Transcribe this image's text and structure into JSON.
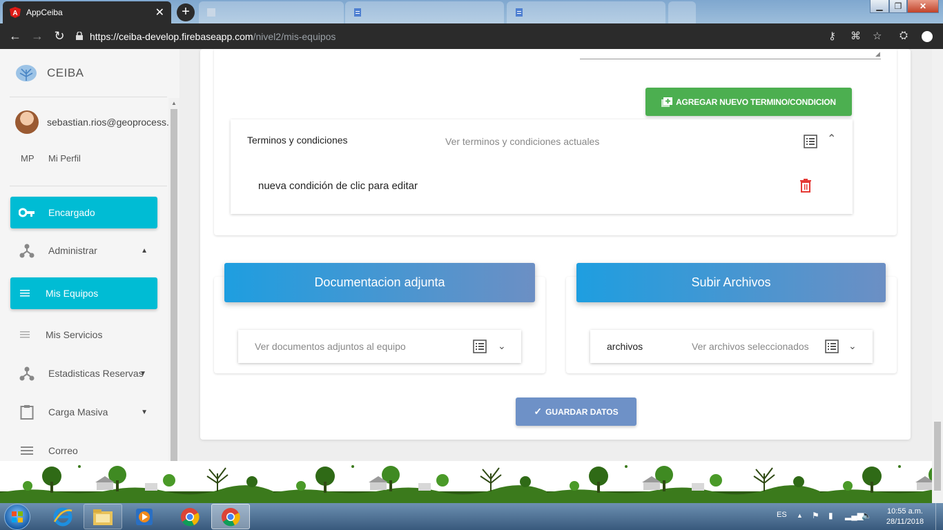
{
  "browser": {
    "active_tab": {
      "title": "AppCeiba",
      "favicon": "angular-icon"
    },
    "inactive_tabs": [
      {
        "title": "",
        "favicon": "generic-page-icon"
      },
      {
        "title": "",
        "favicon": "google-docs-icon"
      },
      {
        "title": "",
        "favicon": "google-docs-icon"
      }
    ],
    "new_tab_label": "+",
    "url_host": "https://ceiba-develop.firebaseapp.com",
    "url_path": "/nivel2/mis-equipos"
  },
  "sidebar": {
    "brand": "CEIBA",
    "user_email": "sebastian.rios@geoprocess.c",
    "profile_abbr": "MP",
    "profile_label": "Mi Perfil",
    "items": [
      {
        "label": "Encargado",
        "icon": "key-icon",
        "active": true
      },
      {
        "label": "Administrar",
        "icon": "hub-icon",
        "active": false,
        "caret": "▲"
      },
      {
        "label": "Mis Equipos",
        "icon": "list-icon",
        "active": true
      },
      {
        "label": "Mis Servicios",
        "icon": "list-icon",
        "active": false
      },
      {
        "label": "Estadisticas Reservas",
        "icon": "hub-icon",
        "active": false,
        "caret": "▼"
      },
      {
        "label": "Carga Masiva",
        "icon": "clipboard-icon",
        "active": false,
        "caret": "▼"
      },
      {
        "label": "Correo",
        "icon": "list-icon",
        "active": false
      }
    ]
  },
  "terms": {
    "add_button": "AGREGAR NUEVO TERMINO/CONDICION",
    "panel_title": "Terminos y condiciones",
    "panel_desc": "Ver terminos y condiciones actuales",
    "items": [
      "nueva condición de clic para editar"
    ]
  },
  "documentation": {
    "header": "Documentacion adjunta",
    "panel_desc": "Ver documentos adjuntos al equipo"
  },
  "upload": {
    "header": "Subir Archivos",
    "panel_title": "archivos",
    "panel_desc": "Ver archivos seleccionados"
  },
  "save_button": "GUARDAR DATOS",
  "colors": {
    "active_nav": "#00bcd4",
    "green_button": "#4caf50",
    "save_button": "#6e91c7",
    "header_gradient_start": "#1e9ee0",
    "header_gradient_end": "#6c8fc4",
    "delete_icon": "#e53935"
  },
  "taskbar": {
    "apps": [
      "start-orb",
      "internet-explorer-icon",
      "file-explorer-icon",
      "media-player-icon",
      "chrome-icon",
      "chrome-icon"
    ],
    "language": "ES",
    "time": "10:55 a.m.",
    "date": "28/11/2018"
  }
}
